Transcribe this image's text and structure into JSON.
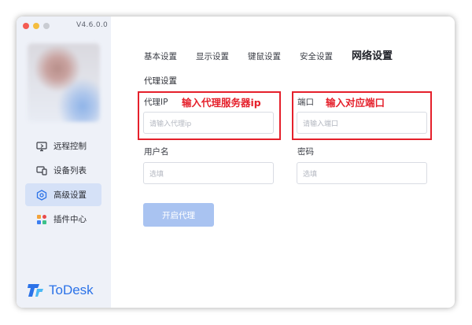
{
  "app": {
    "version": "V4.6.0.0",
    "logo_text": "ToDesk"
  },
  "sidebar": {
    "items": [
      {
        "label": "远程控制",
        "icon": "monitor-icon",
        "active": false
      },
      {
        "label": "设备列表",
        "icon": "devices-icon",
        "active": false
      },
      {
        "label": "高级设置",
        "icon": "hexagon-settings-icon",
        "active": true
      },
      {
        "label": "插件中心",
        "icon": "plugin-grid-icon",
        "active": false
      }
    ]
  },
  "tabs": [
    "基本设置",
    "显示设置",
    "键鼠设置",
    "安全设置",
    "网络设置"
  ],
  "active_tab": "网络设置",
  "proxy": {
    "section_title": "代理设置",
    "ip_label": "代理IP",
    "ip_placeholder": "请输入代理ip",
    "port_label": "端口",
    "port_placeholder": "请输入端口",
    "user_label": "用户名",
    "user_placeholder": "选填",
    "password_label": "密码",
    "password_placeholder": "选填",
    "enable_button": "开启代理"
  },
  "annotations": {
    "ip_note": "输入代理服务器ip",
    "port_note": "输入对应端口"
  },
  "colors": {
    "accent": "#2b72e8",
    "sidebar_bg": "#eef1f8",
    "active_nav_bg": "#d5e1f7",
    "button_bg": "#a9c3f1",
    "annotation_red": "#e5202b"
  }
}
